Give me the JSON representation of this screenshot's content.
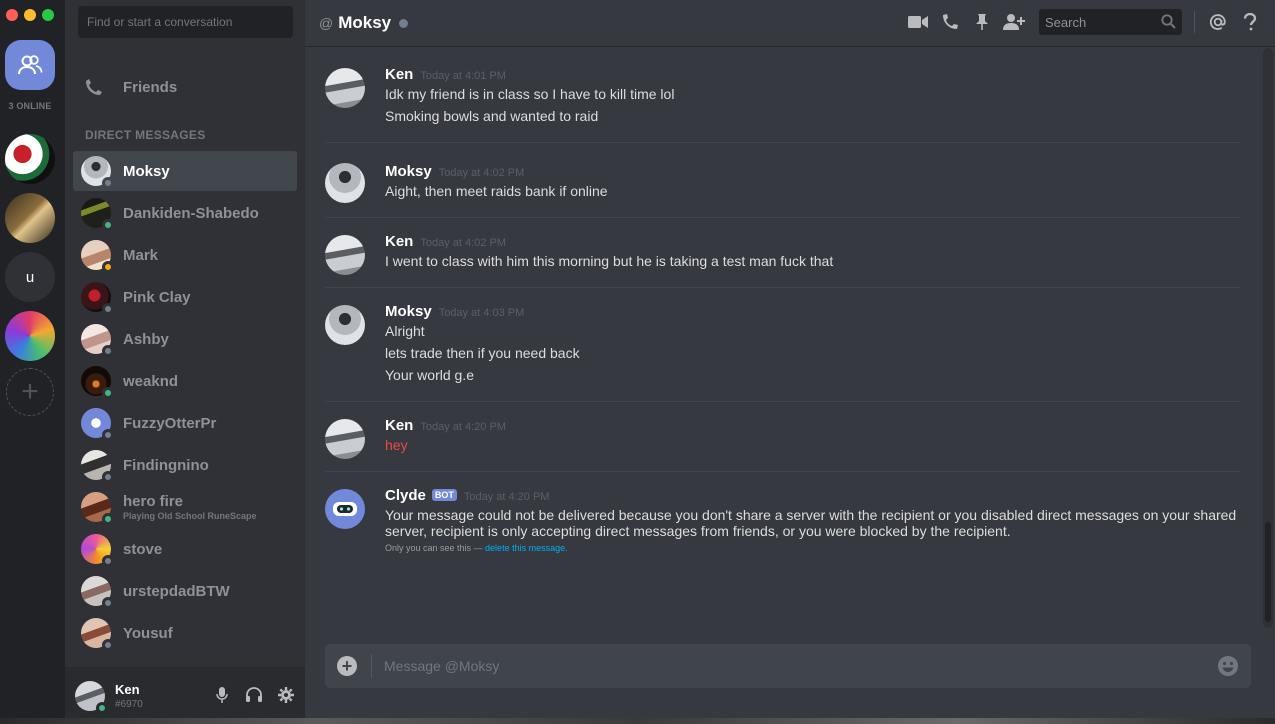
{
  "window": {
    "close_label": "x",
    "minimize_label": "-",
    "maximize_label": "+"
  },
  "rail": {
    "online_count": "3 ONLINE",
    "servers": [
      {
        "name": "server-1"
      },
      {
        "name": "server-2"
      },
      {
        "name": "server-3",
        "initial": "u"
      },
      {
        "name": "server-4"
      }
    ],
    "add_label": "+"
  },
  "sidebar": {
    "search_placeholder": "Find or start a conversation",
    "friends_label": "Friends",
    "dm_header": "DIRECT MESSAGES",
    "dms": [
      {
        "name": "Moksy",
        "status": "offline",
        "active": true
      },
      {
        "name": "Dankiden-Shabedo",
        "status": "online"
      },
      {
        "name": "Mark",
        "status": "idle"
      },
      {
        "name": "Pink Clay",
        "status": "offline"
      },
      {
        "name": "Ashby",
        "status": "offline"
      },
      {
        "name": "weaknd",
        "status": "online"
      },
      {
        "name": "FuzzyOtterPr",
        "status": "offline"
      },
      {
        "name": "Findingnino",
        "status": "offline"
      },
      {
        "name": "hero fire",
        "status": "online",
        "sub": "Playing Old School RuneScape"
      },
      {
        "name": "stove",
        "status": "offline"
      },
      {
        "name": "urstepdadBTW",
        "status": "offline"
      },
      {
        "name": "Yousuf",
        "status": "offline"
      }
    ],
    "user": {
      "name": "Ken",
      "discriminator": "#6970",
      "status": "online"
    }
  },
  "header": {
    "at_symbol": "@",
    "title": "Moksy",
    "search_placeholder": "Search"
  },
  "messages": [
    {
      "author": "Ken",
      "avatar": "ken",
      "time": "Today at 4:01 PM",
      "lines": [
        "Idk my friend is in class so I have to kill time lol",
        "Smoking bowls and wanted to raid"
      ]
    },
    {
      "author": "Moksy",
      "avatar": "moksy",
      "time": "Today at 4:02 PM",
      "lines": [
        "Aight, then meet raids bank if online"
      ]
    },
    {
      "author": "Ken",
      "avatar": "ken",
      "time": "Today at 4:02 PM",
      "lines": [
        "I went to class with him this morning but he is taking a test man fuck that"
      ]
    },
    {
      "author": "Moksy",
      "avatar": "moksy",
      "time": "Today at 4:03 PM",
      "lines": [
        "Alright",
        "lets trade then if you need back",
        "Your world g.e"
      ]
    },
    {
      "author": "Ken",
      "avatar": "ken",
      "time": "Today at 4:20 PM",
      "lines": [
        "hey"
      ],
      "failed": true
    },
    {
      "author": "Clyde",
      "avatar": "clyde",
      "bot": true,
      "bot_tag": "BOT",
      "time": "Today at 4:20 PM",
      "lines": [
        "Your message could not be delivered because you don't share a server with the recipient or you disabled direct messages on your shared server, recipient is only accepting direct messages from friends, or you were blocked by the recipient."
      ],
      "ephemeral_note": "Only you can see this — ",
      "ephemeral_link": "delete this message."
    }
  ],
  "composer": {
    "placeholder": "Message @Moksy"
  },
  "colors": {
    "accent": "#7289da",
    "online": "#43b581",
    "idle": "#faa61a",
    "offline": "#747f8d",
    "error": "#f04747"
  }
}
